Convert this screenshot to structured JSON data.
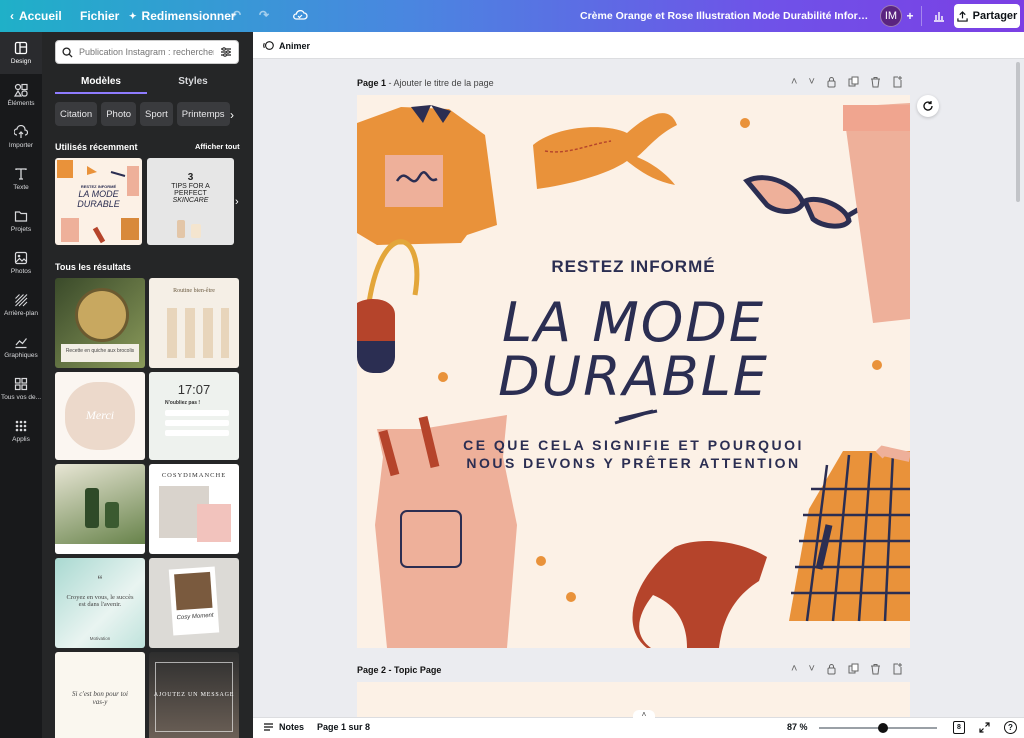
{
  "topbar": {
    "home": "Accueil",
    "file": "Fichier",
    "resize": "Redimensionner",
    "title": "Crème Orange et Rose Illustration Mode Durabilité Informa...",
    "avatar": "IM",
    "share": "Partager"
  },
  "rail": [
    {
      "label": "Design",
      "icon": "design-icon"
    },
    {
      "label": "Éléments",
      "icon": "elements-icon"
    },
    {
      "label": "Importer",
      "icon": "upload-icon"
    },
    {
      "label": "Texte",
      "icon": "text-icon"
    },
    {
      "label": "Projets",
      "icon": "folder-icon"
    },
    {
      "label": "Photos",
      "icon": "image-icon"
    },
    {
      "label": "Arrière-plan",
      "icon": "background-icon"
    },
    {
      "label": "Graphiques",
      "icon": "chart-icon"
    },
    {
      "label": "Tous vos de...",
      "icon": "apps-grid-icon"
    },
    {
      "label": "Applis",
      "icon": "apps-icon"
    }
  ],
  "panel": {
    "search_placeholder": "Publication Instagram : rechercher",
    "tabs": [
      "Modèles",
      "Styles"
    ],
    "chips": [
      "Citation",
      "Photo",
      "Sport",
      "Printemps"
    ],
    "recent_title": "Utilisés récemment",
    "see_all": "Afficher tout",
    "results_title": "Tous les résultats",
    "recent": [
      {
        "lines": [
          "RESTEZ INFORMÉ",
          "LA MODE",
          "DURABLE"
        ]
      },
      {
        "lines": [
          "3",
          "TIPS FOR A",
          "PERFECT",
          "SKINCARE"
        ]
      }
    ],
    "results": [
      {
        "text": "Recette en quiche aux brocolis"
      },
      {
        "text": "Routine bien-être"
      },
      {
        "text": "Merci"
      },
      {
        "text": "17:07",
        "sub": "N'oubliez pas !"
      },
      {
        "text": ""
      },
      {
        "text": "COSYDIMANCHE"
      },
      {
        "text": "Croyez en vous, le succès est dans l'avenir.",
        "sub": "Motivation"
      },
      {
        "text": "Cosy Moment"
      },
      {
        "text": "Si c'est bon pour toi vas-y"
      },
      {
        "text": "AJOUTEZ UN MESSAGE"
      }
    ]
  },
  "editor": {
    "animate": "Animer",
    "page1_label": "Page 1",
    "page1_hint": " - Ajouter le titre de la page",
    "page2_label": "Page 2 - Topic Page"
  },
  "design": {
    "kicker": "RESTEZ INFORMÉ",
    "title_line1": "LA MODE",
    "title_line2": "DURABLE",
    "sub_line1": "CE QUE CELA SIGNIFIE ET POURQUOI",
    "sub_line2": "NOUS DEVONS Y PRÊTER ATTENTION"
  },
  "status": {
    "notes": "Notes",
    "page_indicator": "Page 1 sur 8",
    "zoom": "87 %",
    "zoom_fraction": 0.54,
    "page_count_badge": "8"
  },
  "colors": {
    "accent": "#8f7cff",
    "design_bg": "#fcf1e6",
    "design_text": "#2b2e52",
    "orange": "#e9923a",
    "pink": "#eeb09a",
    "rust": "#b5442b"
  }
}
